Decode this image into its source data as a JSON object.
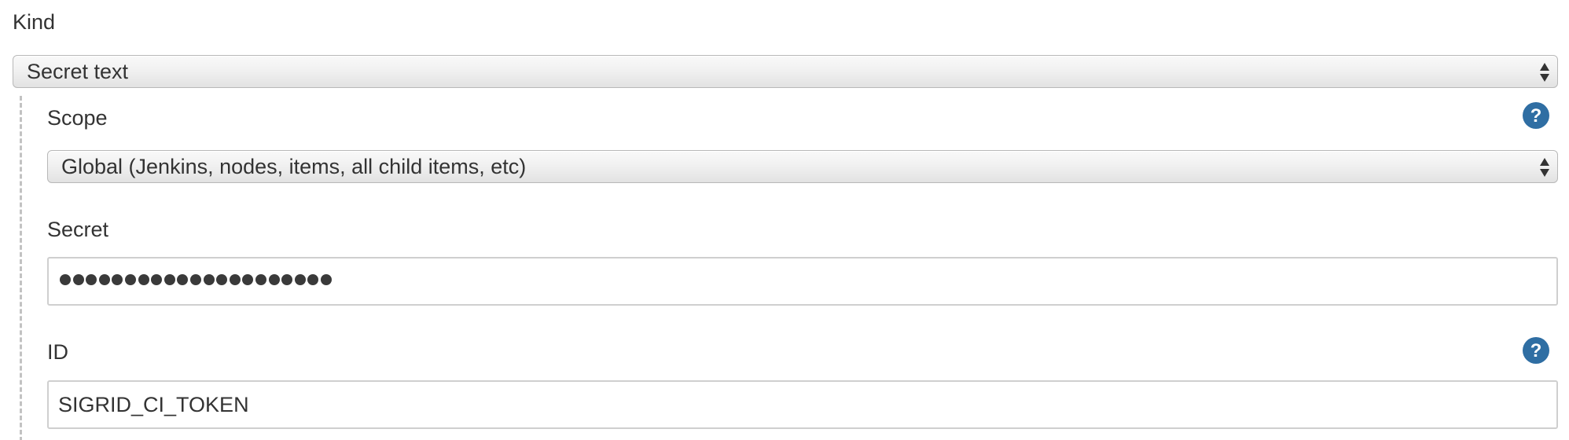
{
  "kind": {
    "label": "Kind",
    "selected": "Secret text"
  },
  "scope": {
    "label": "Scope",
    "selected": "Global (Jenkins, nodes, items, all child items, etc)"
  },
  "secret": {
    "label": "Secret",
    "masked_char_count": 21
  },
  "id": {
    "label": "ID",
    "value": "SIGRID_CI_TOKEN"
  },
  "colors": {
    "help_icon": "#2f6ea3",
    "text": "#333333",
    "dashed_rule": "#c2c2c2"
  },
  "icons": {
    "help": "help-icon",
    "select_arrows": "updown-arrows-icon"
  }
}
